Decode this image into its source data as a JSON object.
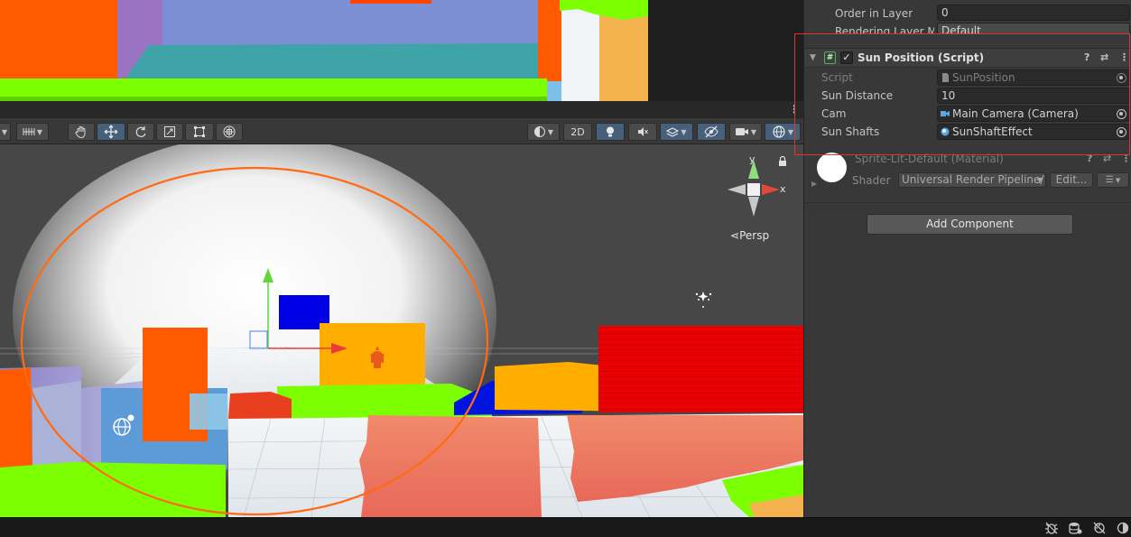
{
  "inspector": {
    "top_rows": [
      {
        "label": "Order in Layer",
        "value": "0"
      },
      {
        "label": "Rendering Layer Ma",
        "value": "Default"
      }
    ],
    "component": {
      "title": "Sun Position (Script)",
      "script_icon": "#",
      "enabled_mark": "✓",
      "fields": [
        {
          "label": "Script",
          "value": "SunPosition",
          "icon": "script-file-icon"
        },
        {
          "label": "Sun Distance",
          "value": "10"
        },
        {
          "label": "Cam",
          "value": "Main Camera (Camera)",
          "icon": "camera-icon"
        },
        {
          "label": "Sun Shafts",
          "value": "SunShaftEffect",
          "icon": "component-icon"
        }
      ]
    },
    "material": {
      "title": "Sprite-Lit-Default (Material)",
      "shader_label": "Shader",
      "shader_value": "Universal Render Pipeline/",
      "edit_label": "Edit..."
    },
    "add_component_label": "Add Component"
  },
  "scene_toolbar": {
    "mode_2d_label": "2D"
  },
  "gizmo": {
    "axis_y": "y",
    "axis_x": "x",
    "projection_label": "Persp"
  },
  "colors": {
    "highlight": "#e23232",
    "selection_orange": "#ff6a13",
    "toolbar_active": "#46607c"
  }
}
